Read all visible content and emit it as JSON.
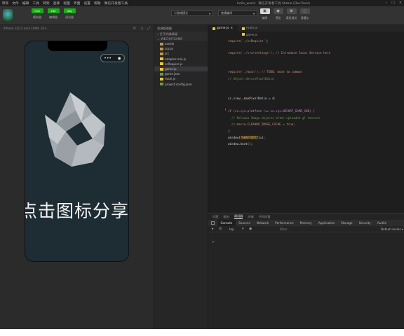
{
  "menubar": {
    "items": [
      "项目",
      "文件",
      "编辑",
      "工具",
      "转到",
      "选择",
      "视图",
      "界面",
      "设置",
      "帮助",
      "微信开发者工具"
    ],
    "title": "hello_world · 微信开发者工具 Stable (DevTools)"
  },
  "toolbar": {
    "modes": [
      {
        "box": "mini",
        "label": "模拟器"
      },
      {
        "box": "edit",
        "label": "编辑器"
      },
      {
        "box": "dbg",
        "label": "调试器"
      }
    ],
    "mode_select": "小游戏模式",
    "compile_select": "普通编译",
    "icons": [
      {
        "glyph": "▣",
        "label": "编译"
      },
      {
        "glyph": "◉",
        "label": "预览"
      },
      {
        "glyph": "⚙",
        "label": "真机调试"
      },
      {
        "glyph": "◌",
        "label": "清缓存"
      }
    ]
  },
  "simulator": {
    "device": "iPhone 12/13 mini 100% 16 ▾",
    "share_text": "点击图标分享"
  },
  "explorer": {
    "header": "资源管理器",
    "open_editors": "打开的编辑器",
    "root": "WECHATGAME",
    "items": [
      {
        "name": "assets",
        "type": "folder",
        "indent": 1
      },
      {
        "name": "cocos",
        "type": "folder",
        "indent": 1
      },
      {
        "name": "src",
        "type": "folder",
        "indent": 1
      },
      {
        "name": "adapter-min.js",
        "type": "js",
        "indent": 1
      },
      {
        "name": "ccRequire.js",
        "type": "js",
        "indent": 1
      },
      {
        "name": "game.js",
        "type": "js",
        "indent": 1,
        "selected": true
      },
      {
        "name": "game.json",
        "type": "json",
        "indent": 1
      },
      {
        "name": "main.js",
        "type": "js",
        "indent": 1
      },
      {
        "name": "project.config.json",
        "type": "json",
        "indent": 1
      }
    ]
  },
  "editor": {
    "tabs": [
      {
        "label": "game.js",
        "active": true
      },
      {
        "label": "main.js",
        "active": false
      }
    ],
    "breadcrumb": "game.js",
    "lines": [
      {
        "text": "require('./ccRequire');"
      },
      {
        "text": "require('./src/settings'); // Introduce Cocos Service here"
      },
      {
        "text": "require('./main'); // TODO: move to common"
      },
      {
        "text": "// Adjust devicePixelRatio"
      },
      {
        "text": "cc.view._maxPixelRatio = 4;"
      },
      {
        "text": "if (cc.sys.platform !== cc.sys.WECHAT_GAME_SUB) {"
      },
      {
        "text": "  // Release Image objects after uploaded gl texture"
      },
      {
        "text": "  cc.macro.CLEANUP_IMAGE_CACHE = true;"
      },
      {
        "text": "}"
      },
      {
        "text": "window.boot();"
      }
    ],
    "highlight_line": {
      "prefix": "window[",
      "highlight": "\"SHAFTOPT\"",
      "suffix": "]=1;"
    }
  },
  "panel": {
    "tabs": [
      "问题",
      "输出",
      "调试器",
      "终端",
      "代码质量"
    ],
    "active_tab": "调试器",
    "devtools_tabs": [
      "Console",
      "Sources",
      "Network",
      "Performance",
      "Memory",
      "Application",
      "Storage",
      "Security",
      "Audits"
    ],
    "context": "top",
    "filter_placeholder": "Filter",
    "levels": "Default levels ▾",
    "prompt": ">"
  }
}
